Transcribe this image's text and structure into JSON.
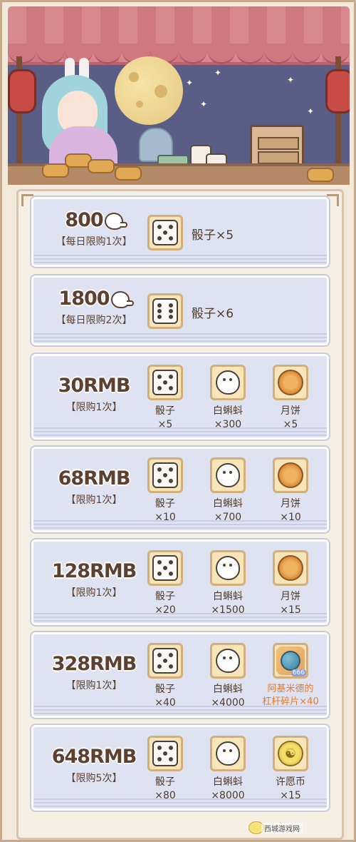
{
  "colors": {
    "price_text": "#5c4030",
    "card_bg": "#dfe3f1",
    "item_bg": "#f7e4b9",
    "special_label": "#e07a2e",
    "curtain": "#cf7880",
    "night_sky": "#5a5d86"
  },
  "offers": [
    {
      "price": "800",
      "price_icon": "tadpole-currency-icon",
      "limit": "【每日限购1次】",
      "rewards": [
        {
          "icon": "dice-icon",
          "label": "骰子×5"
        }
      ]
    },
    {
      "price": "1800",
      "price_icon": "tadpole-currency-icon",
      "limit": "【每日限购2次】",
      "rewards": [
        {
          "icon": "dice-icon",
          "label": "骰子×6"
        }
      ]
    },
    {
      "price": "30RMB",
      "limit": "【限购1次】",
      "rewards": [
        {
          "icon": "dice-icon",
          "name": "骰子",
          "qty": "×5"
        },
        {
          "icon": "tadpole-icon",
          "name": "白蝌蚪",
          "qty": "×300"
        },
        {
          "icon": "mooncake-icon",
          "name": "月饼",
          "qty": "×5"
        }
      ]
    },
    {
      "price": "68RMB",
      "limit": "【限购1次】",
      "rewards": [
        {
          "icon": "dice-icon",
          "name": "骰子",
          "qty": "×10"
        },
        {
          "icon": "tadpole-icon",
          "name": "白蝌蚪",
          "qty": "×700"
        },
        {
          "icon": "mooncake-icon",
          "name": "月饼",
          "qty": "×10"
        }
      ]
    },
    {
      "price": "128RMB",
      "limit": "【限购1次】",
      "rewards": [
        {
          "icon": "dice-icon",
          "name": "骰子",
          "qty": "×20"
        },
        {
          "icon": "tadpole-icon",
          "name": "白蝌蚪",
          "qty": "×1500"
        },
        {
          "icon": "mooncake-icon",
          "name": "月饼",
          "qty": "×15"
        }
      ]
    },
    {
      "price": "328RMB",
      "limit": "【限购1次】",
      "rewards": [
        {
          "icon": "dice-icon",
          "name": "骰子",
          "qty": "×40"
        },
        {
          "icon": "tadpole-icon",
          "name": "白蝌蚪",
          "qty": "×4000"
        },
        {
          "icon": "archimedes-lever-fragment-icon",
          "name": "阿基米德的",
          "qty": "杠杆碎片×40",
          "badge": "666",
          "special": true
        }
      ]
    },
    {
      "price": "648RMB",
      "limit": "【限购5次】",
      "rewards": [
        {
          "icon": "dice-icon",
          "name": "骰子",
          "qty": "×80"
        },
        {
          "icon": "tadpole-icon",
          "name": "白蝌蚪",
          "qty": "×8000"
        },
        {
          "icon": "wish-coin-icon",
          "name": "许愿币",
          "qty": "×15"
        }
      ]
    }
  ],
  "watermark": "西城游戏网"
}
